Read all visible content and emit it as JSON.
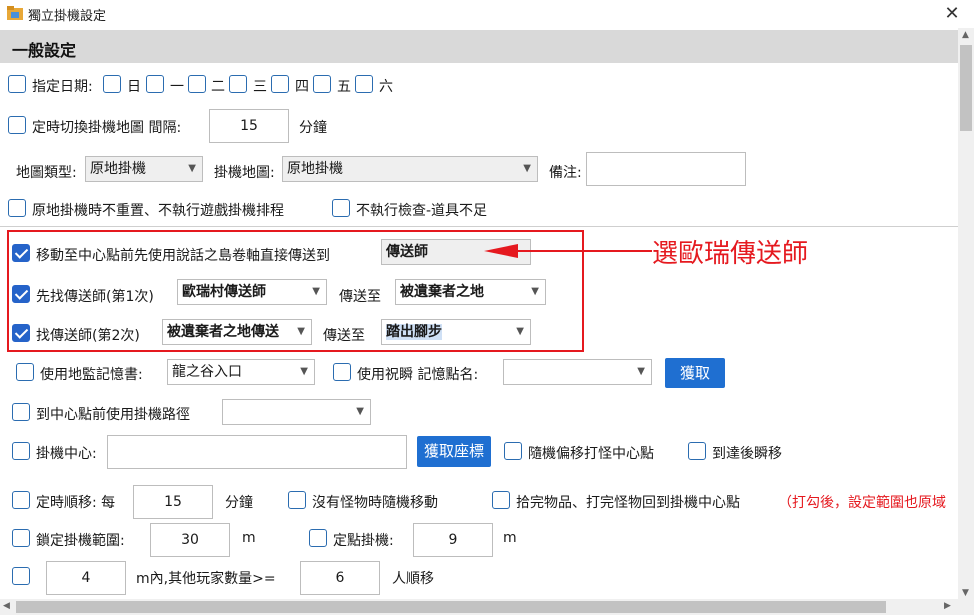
{
  "window": {
    "title": "獨立掛機設定",
    "close": "✕"
  },
  "section": {
    "title": "一般設定"
  },
  "days": {
    "label": "指定日期:",
    "items": [
      "日",
      "一",
      "二",
      "三",
      "四",
      "五",
      "六"
    ]
  },
  "map_switch": {
    "label": "定時切換掛機地圖 間隔:",
    "value": "15",
    "unit": "分鐘"
  },
  "map_type": {
    "label": "地圖類型:",
    "value": "原地掛機"
  },
  "idle_map": {
    "label": "掛機地圖:",
    "value": "原地掛機"
  },
  "note": {
    "label": "備注:",
    "value": ""
  },
  "no_reset": {
    "label": "原地掛機時不重置、不執行遊戲掛機排程"
  },
  "no_check": {
    "label": "不執行檢查-道具不足"
  },
  "scroll_teleport": {
    "label": "移動至中心點前先使用說話之島卷軸直接傳送到",
    "value": "傳送師",
    "checked": true
  },
  "annotation": {
    "text": "選歐瑞傳送師"
  },
  "teleporter1": {
    "label": "先找傳送師(第1次)",
    "value": "歐瑞村傳送師",
    "to_label": "傳送至",
    "to_value": "被遺棄者之地",
    "checked": true
  },
  "teleporter2": {
    "label": "找傳送師(第2次)",
    "value": "被遺棄者之地傳送",
    "to_label": "傳送至",
    "to_value": "踏出腳步",
    "checked": true
  },
  "memory_book": {
    "label": "使用地監記憶書:",
    "value": "龍之谷入口"
  },
  "blessing": {
    "label": "使用祝瞬 記憶點名:",
    "value": ""
  },
  "fetch_button": "獲取",
  "path": {
    "label": "到中心點前使用掛機路徑",
    "value": ""
  },
  "center": {
    "label": "掛機中心:",
    "value": ""
  },
  "fetch_coords_button": "獲取座標",
  "random_offset": {
    "label": "隨機偏移打怪中心點"
  },
  "arrive_teleport": {
    "label": "到達後瞬移"
  },
  "timed_move": {
    "label": "定時順移: 每",
    "value": "15",
    "unit": "分鐘"
  },
  "no_monster": {
    "label": "沒有怪物時隨機移動"
  },
  "return_center": {
    "label": "拾完物品、打完怪物回到掛機中心點",
    "hint": "（打勾後，設定範圍也原域"
  },
  "lock_range": {
    "label": "鎖定掛機範圍:",
    "value": "30",
    "unit": "m"
  },
  "fixed_point": {
    "label": "定點掛機:",
    "value": "9",
    "unit": "m"
  },
  "players": {
    "value1": "4",
    "mid": "m內,其他玩家數量>=",
    "value2": "6",
    "unit": "人順移"
  },
  "colors": {
    "accent": "#2563c9",
    "annotation": "#e5191f",
    "header_bg": "#d9d9d9"
  },
  "icons": {
    "app": "folder-icon",
    "close": "close-icon",
    "dropdown": "chevron-down-icon"
  }
}
